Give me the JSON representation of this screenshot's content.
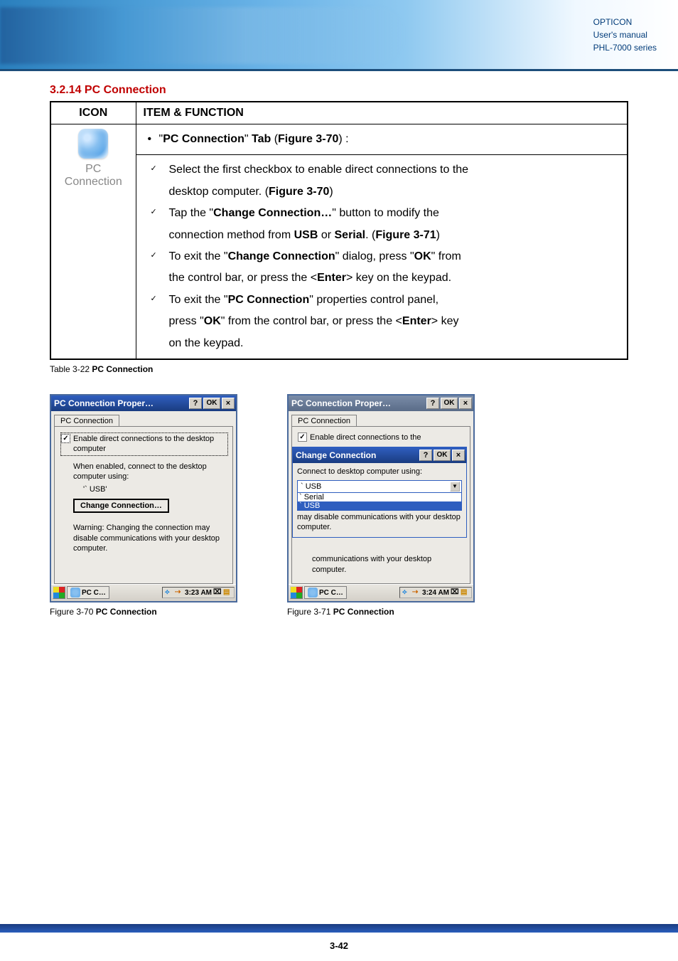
{
  "header": {
    "brand": "OPTICON",
    "line2": "User's manual",
    "line3": "PHL-7000 series"
  },
  "section": {
    "title": "3.2.14 PC Connection"
  },
  "table": {
    "head_icon": "ICON",
    "head_item": "ITEM & FUNCTION",
    "icon_label": "PC\nConnection",
    "row1": "\"PC Connection\" Tab (Figure 3-70) :",
    "check1_a": "Select the first checkbox to enable direct connections to the",
    "check1_b": "desktop computer. (Figure 3-70)",
    "check2_a": "Tap the \"Change Connection…\" button to modify the",
    "check2_b": "connection method from USB or Serial. (Figure 3-71)",
    "check3_a": "To exit the \"Change Connection\" dialog, press \"OK\" from",
    "check3_b": "the control bar, or press the <Enter> key on the keypad.",
    "check4_a": "To exit the \"PC Connection\" properties control panel,",
    "check4_b": "press \"OK\" from the control bar, or press the <Enter> key",
    "check4_c": "on the keypad."
  },
  "table_caption_prefix": "Table 3-22 ",
  "table_caption_bold": "PC Connection",
  "fig70": {
    "title": "PC Connection Proper…",
    "help": "?",
    "ok": "OK",
    "close": "×",
    "tab": "PC Connection",
    "checkbox_label": "Enable direct connections to the desktop computer",
    "when_enabled": "When enabled, connect to the desktop computer using:",
    "conn_value": "'` USB'",
    "change_btn": "Change Connection…",
    "warning": "Warning: Changing the connection may disable communications with your desktop computer.",
    "taskbar_app": "PC C…",
    "tray_time": "3:23 AM",
    "caption_prefix": "Figure 3-70 ",
    "caption_bold": "PC Connection"
  },
  "fig71": {
    "title": "PC Connection Proper…",
    "help": "?",
    "ok": "OK",
    "close": "×",
    "tab": "PC Connection",
    "checkbox_label": "Enable direct connections to the",
    "overlay_title": "Change Connection",
    "overlay_help": "?",
    "overlay_ok": "OK",
    "overlay_close": "×",
    "connect_label": "Connect to desktop computer using:",
    "dd_selected": "` USB",
    "dd_opt1": "` Serial",
    "dd_opt2": "` USB",
    "overlay_note": "may disable communications with your desktop computer.",
    "below_note": "communications with your desktop computer.",
    "taskbar_app": "PC C…",
    "tray_time": "3:24 AM",
    "caption_prefix": "Figure 3-71 ",
    "caption_bold": "PC Connection"
  },
  "footer": {
    "page": "3-42"
  }
}
